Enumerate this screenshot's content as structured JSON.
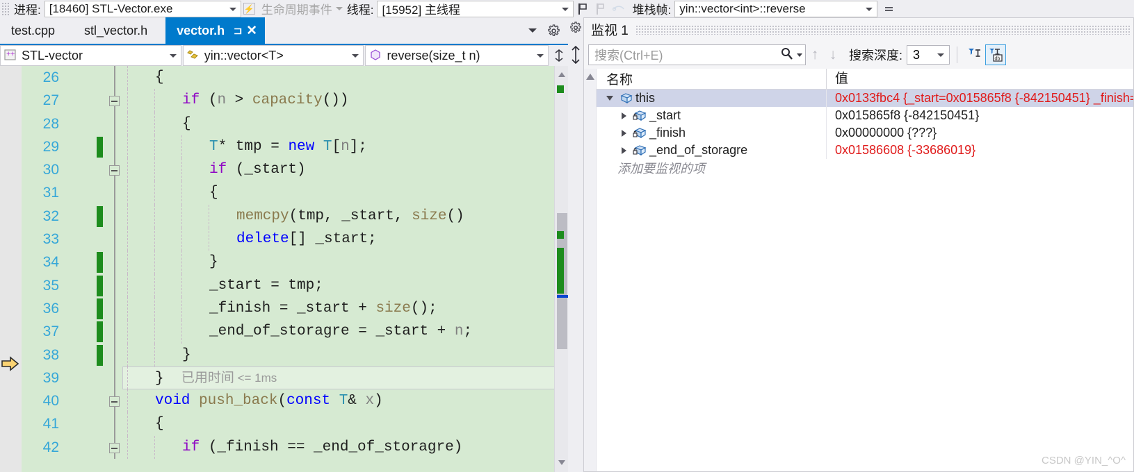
{
  "debug_toolbar": {
    "process_label": "进程:",
    "process_value": "[18460] STL-Vector.exe",
    "lifecycle_label": "生命周期事件",
    "thread_label": "线程:",
    "thread_value": "[15952] 主线程",
    "stack_label": "堆栈帧:",
    "stack_value": "yin::vector<int>::reverse"
  },
  "editor": {
    "tabs": [
      {
        "label": "test.cpp",
        "active": false
      },
      {
        "label": "stl_vector.h",
        "active": false
      },
      {
        "label": "vector.h",
        "active": true
      }
    ],
    "tab_pin": "⊐",
    "tab_close": "✕",
    "nav": {
      "project": "STL-vector",
      "class": "yin::vector<T>",
      "member": "reverse(size_t n)"
    },
    "elapsed_cn": "已用时间",
    "elapsed_val": "<= 1ms",
    "lines": [
      {
        "no": "26",
        "indent": 1,
        "fold": false,
        "change": false,
        "cur": false,
        "tokens": [
          {
            "t": "{",
            "c": "id"
          }
        ]
      },
      {
        "no": "27",
        "indent": 2,
        "fold": true,
        "change": false,
        "cur": false,
        "tokens": [
          {
            "t": "if",
            "c": "kw"
          },
          {
            "t": " (",
            "c": "id"
          },
          {
            "t": "n",
            "c": "dim2"
          },
          {
            "t": " > ",
            "c": "id"
          },
          {
            "t": "capacity",
            "c": "fn"
          },
          {
            "t": "())",
            "c": "id"
          }
        ]
      },
      {
        "no": "28",
        "indent": 2,
        "fold": false,
        "change": false,
        "cur": false,
        "tokens": [
          {
            "t": "{",
            "c": "id"
          }
        ]
      },
      {
        "no": "29",
        "indent": 3,
        "fold": false,
        "change": true,
        "cur": false,
        "tokens": [
          {
            "t": "T",
            "c": "typ"
          },
          {
            "t": "* tmp = ",
            "c": "id"
          },
          {
            "t": "new",
            "c": "kwb"
          },
          {
            "t": " ",
            "c": "id"
          },
          {
            "t": "T",
            "c": "typ"
          },
          {
            "t": "[",
            "c": "id"
          },
          {
            "t": "n",
            "c": "dim2"
          },
          {
            "t": "];",
            "c": "id"
          }
        ]
      },
      {
        "no": "30",
        "indent": 3,
        "fold": true,
        "change": false,
        "cur": false,
        "tokens": [
          {
            "t": "if",
            "c": "kw"
          },
          {
            "t": " (_start)",
            "c": "id"
          }
        ]
      },
      {
        "no": "31",
        "indent": 3,
        "fold": false,
        "change": false,
        "cur": false,
        "tokens": [
          {
            "t": "{",
            "c": "id"
          }
        ]
      },
      {
        "no": "32",
        "indent": 4,
        "fold": false,
        "change": true,
        "cur": false,
        "tokens": [
          {
            "t": "memcpy",
            "c": "fn"
          },
          {
            "t": "(tmp, _start, ",
            "c": "id"
          },
          {
            "t": "size",
            "c": "fn"
          },
          {
            "t": "()",
            "c": "id"
          }
        ]
      },
      {
        "no": "33",
        "indent": 4,
        "fold": false,
        "change": false,
        "cur": false,
        "tokens": [
          {
            "t": "delete",
            "c": "kwb"
          },
          {
            "t": "[] _start;",
            "c": "id"
          }
        ]
      },
      {
        "no": "34",
        "indent": 3,
        "fold": false,
        "change": true,
        "cur": false,
        "tokens": [
          {
            "t": "}",
            "c": "id"
          }
        ]
      },
      {
        "no": "35",
        "indent": 3,
        "fold": false,
        "change": true,
        "cur": false,
        "tokens": [
          {
            "t": "_start = tmp;",
            "c": "id"
          }
        ]
      },
      {
        "no": "36",
        "indent": 3,
        "fold": false,
        "change": true,
        "cur": false,
        "tokens": [
          {
            "t": "_finish = _start + ",
            "c": "id"
          },
          {
            "t": "size",
            "c": "fn"
          },
          {
            "t": "();",
            "c": "id"
          }
        ]
      },
      {
        "no": "37",
        "indent": 3,
        "fold": false,
        "change": true,
        "cur": false,
        "tokens": [
          {
            "t": "_end_of_storagre = _start + ",
            "c": "id"
          },
          {
            "t": "n",
            "c": "dim2"
          },
          {
            "t": ";",
            "c": "id"
          }
        ]
      },
      {
        "no": "38",
        "indent": 2,
        "fold": false,
        "change": true,
        "cur": false,
        "tokens": [
          {
            "t": "}",
            "c": "id"
          }
        ]
      },
      {
        "no": "39",
        "indent": 1,
        "fold": false,
        "change": false,
        "cur": true,
        "tokens": [
          {
            "t": "}",
            "c": "id"
          }
        ]
      },
      {
        "no": "40",
        "indent": 1,
        "fold": true,
        "change": false,
        "cur": false,
        "tokens": [
          {
            "t": "void",
            "c": "kwb"
          },
          {
            "t": " ",
            "c": "id"
          },
          {
            "t": "push_back",
            "c": "fn"
          },
          {
            "t": "(",
            "c": "id"
          },
          {
            "t": "const",
            "c": "kwb"
          },
          {
            "t": " ",
            "c": "id"
          },
          {
            "t": "T",
            "c": "typ"
          },
          {
            "t": "& ",
            "c": "id"
          },
          {
            "t": "x",
            "c": "dim2"
          },
          {
            "t": ")",
            "c": "id"
          }
        ]
      },
      {
        "no": "41",
        "indent": 1,
        "fold": false,
        "change": false,
        "cur": false,
        "tokens": [
          {
            "t": "{",
            "c": "id"
          }
        ]
      },
      {
        "no": "42",
        "indent": 2,
        "fold": true,
        "change": false,
        "cur": false,
        "tokens": [
          {
            "t": "if",
            "c": "kw"
          },
          {
            "t": " (_finish == _end_of_storagre)",
            "c": "id"
          }
        ]
      }
    ]
  },
  "watch": {
    "title": "监视 1",
    "search_placeholder": "搜索(Ctrl+E)",
    "depth_label": "搜索深度:",
    "depth_value": "3",
    "col_name": "名称",
    "col_value": "值",
    "add_item": "添加要监视的项",
    "rows": [
      {
        "name": "this",
        "value": "0x0133fbc4 {_start=0x015865f8 {-842150451} _finish=",
        "expanded": true,
        "selected": true,
        "level": 0,
        "red": true,
        "locked": false
      },
      {
        "name": "_start",
        "value": "0x015865f8 {-842150451}",
        "expanded": false,
        "selected": false,
        "level": 1,
        "red": false,
        "locked": true
      },
      {
        "name": "_finish",
        "value": "0x00000000 {???}",
        "expanded": false,
        "selected": false,
        "level": 1,
        "red": false,
        "locked": true
      },
      {
        "name": "_end_of_storagre",
        "value": "0x01586608 {-33686019}",
        "expanded": false,
        "selected": false,
        "level": 1,
        "red": true,
        "locked": true
      }
    ]
  },
  "watermark": "CSDN @YIN_^O^"
}
